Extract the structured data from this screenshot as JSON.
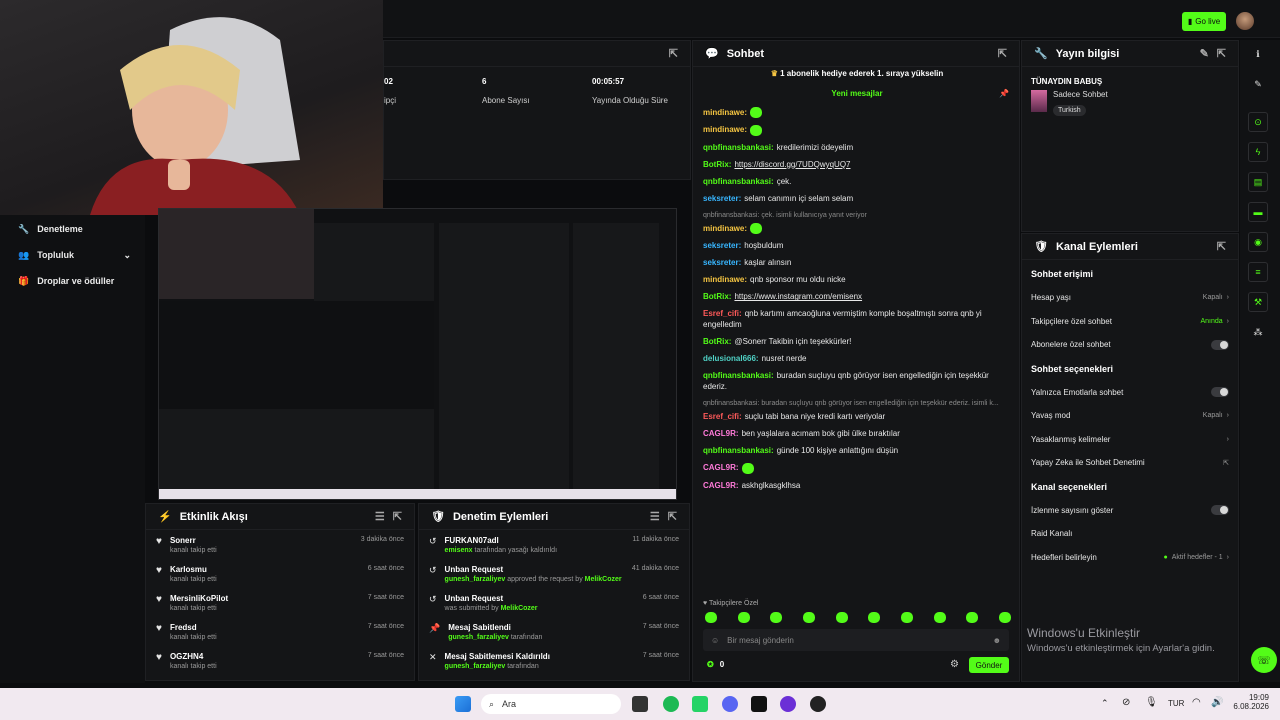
{
  "topbar": {
    "go_live": "Go live"
  },
  "sidebar": {
    "items": [
      {
        "label": "Denetleme"
      },
      {
        "label": "Topluluk"
      },
      {
        "label": "Droplar ve ödüller"
      }
    ]
  },
  "stats": [
    {
      "value": "02",
      "label": "ipçi"
    },
    {
      "value": "6",
      "label": "Abone Sayısı"
    },
    {
      "value": "00:05:57",
      "label": "Yayında Olduğu Süre"
    }
  ],
  "activity": {
    "title": "Etkinlik Akışı",
    "rows": [
      {
        "name": "Sonerr",
        "sub": "kanalı takip etti",
        "time": "3 dakika önce"
      },
      {
        "name": "Karlosmu",
        "sub": "kanalı takip etti",
        "time": "6 saat önce"
      },
      {
        "name": "MersinliKoPilot",
        "sub": "kanalı takip etti",
        "time": "7 saat önce"
      },
      {
        "name": "Fredsd",
        "sub": "kanalı takip etti",
        "time": "7 saat önce"
      },
      {
        "name": "OGZHN4",
        "sub": "kanalı takip etti",
        "time": "7 saat önce"
      }
    ]
  },
  "modlog": {
    "title": "Denetim Eylemleri",
    "rows": [
      {
        "title": "FURKAN07adl",
        "user": "emisenx",
        "rest": " tarafından yasağı kaldırıldı",
        "user2": "",
        "time": "11 dakika önce"
      },
      {
        "title": "Unban Request",
        "user": "gunesh_farzaliyev",
        "rest": " approved the request by ",
        "user2": "MelikCozer",
        "time": "41 dakika önce"
      },
      {
        "title": "Unban Request",
        "user": "",
        "rest": "was submitted by ",
        "user2": "MelikCozer",
        "time": "6 saat önce"
      },
      {
        "title": "Mesaj Sabitlendi",
        "user": "gunesh_farzaliyev",
        "rest": " tarafından",
        "user2": "",
        "time": "7 saat önce"
      },
      {
        "title": "Mesaj Sabitlemesi Kaldırıldı",
        "user": "gunesh_farzaliyev",
        "rest": " tarafından",
        "user2": "",
        "time": "7 saat önce"
      }
    ]
  },
  "chat": {
    "title": "Sohbet",
    "banner": "1 abonelik hediye ederek 1. sıraya yükselin",
    "new_messages": "Yeni mesajlar",
    "followers_only": "Takipçilere Özel",
    "input_placeholder": "Bir mesaj gönderin",
    "send": "Gönder",
    "count": "0",
    "messages": [
      {
        "user": "mindinawe:",
        "color": "#f5c542",
        "text": "",
        "emote": true
      },
      {
        "user": "mindinawe:",
        "color": "#f5c542",
        "text": "",
        "emote": true
      },
      {
        "user": "qnbfinansbankasi:",
        "color": "#53fc18",
        "text": "kredilerimizi ödeyelim"
      },
      {
        "user": "BotRix:",
        "color": "#53fc18",
        "text": "https://discord.gg/7UDQwyqUQ7",
        "link": true
      },
      {
        "user": "qnbfinansbankasi:",
        "color": "#53fc18",
        "text": "çek."
      },
      {
        "user": "seksreter:",
        "color": "#38b6ff",
        "text": "selam canımın içi selam selam"
      },
      {
        "reply": "qnbfinansbankasi: çek. isimli kullanıcıya yanıt veriyor",
        "user": "mindinawe:",
        "color": "#f5c542",
        "text": "",
        "emote": true
      },
      {
        "user": "seksreter:",
        "color": "#38b6ff",
        "text": "hoşbuldum"
      },
      {
        "user": "seksreter:",
        "color": "#38b6ff",
        "text": "kaşlar alınsın"
      },
      {
        "user": "mindinawe:",
        "color": "#f5c542",
        "text": "qnb sponsor mu oldu nicke"
      },
      {
        "user": "BotRix:",
        "color": "#53fc18",
        "text": "https://www.instagram.com/emisenx",
        "link": true
      },
      {
        "user": "Esref_cifi:",
        "color": "#ff5a5a",
        "text": "qnb kartımı amcaoğluna vermiştim komple boşaltmıştı sonra qnb yi engelledim"
      },
      {
        "user": "BotRix:",
        "color": "#53fc18",
        "text": "@Sonerr Takibin için teşekkürler!"
      },
      {
        "user": "delusional666:",
        "color": "#4fd1c5",
        "text": "nusret nerde"
      },
      {
        "user": "qnbfinansbankasi:",
        "color": "#53fc18",
        "text": "buradan suçluyu qnb görüyor isen engellediğin için teşekkür ederiz."
      },
      {
        "reply": "qnbfinansbankasi: buradan suçluyu qnb görüyor isen engellediğin için teşekkür ederiz. isimli k...",
        "user": "Esref_cifi:",
        "color": "#ff5a5a",
        "text": "suçlu tabi bana niye kredi kartı veriyolar"
      },
      {
        "user": "CAGL9R:",
        "color": "#ff7ad9",
        "text": "ben yaşlalara acımam bok gibi ülke bıraktılar"
      },
      {
        "user": "qnbfinansbankasi:",
        "color": "#53fc18",
        "text": "günde 100 kişiye anlattığını düşün"
      },
      {
        "user": "CAGL9R:",
        "color": "#ff7ad9",
        "text": "",
        "emote": true
      },
      {
        "user": "CAGL9R:",
        "color": "#ff7ad9",
        "text": "askhglkasgklhsa"
      }
    ]
  },
  "stream_info": {
    "title": "Yayın bilgisi",
    "stream_title": "TÜNAYDIN BABUŞ",
    "category": "Sadece Sohbet",
    "tag": "Turkish"
  },
  "channel_actions": {
    "title": "Kanal Eylemleri",
    "chat_access": "Sohbet erişimi",
    "account_age": "Hesap yaşı",
    "account_age_val": "Kapalı",
    "followers_only": "Takipçilere özel sohbet",
    "followers_only_val": "Anında",
    "subs_only": "Abonelere özel sohbet",
    "chat_options": "Sohbet seçenekleri",
    "emotes_only": "Yalnızca Emotlarla sohbet",
    "slow_mode": "Yavaş mod",
    "slow_mode_val": "Kapalı",
    "banned_words": "Yasaklanmış kelimeler",
    "ai_moderation": "Yapay Zeka ile Sohbet Denetimi",
    "channel_options": "Kanal seçenekleri",
    "show_viewers": "İzlenme sayısını göster",
    "raid": "Raid Kanalı",
    "goals": "Hedefleri belirleyin",
    "goals_val": "Aktif hedefler - 1"
  },
  "watermark": {
    "line1": "Windows'u Etkinleştir",
    "line2": "Windows'u etkinleştirmek için Ayarlar'a gidin."
  },
  "taskbar": {
    "search": "Ara",
    "lang": "TUR",
    "time": "19:09",
    "date": "6.08.2026"
  },
  "colors": {
    "accent": "#53fc18",
    "bg": "#0b0c0e",
    "panel": "#141517"
  }
}
